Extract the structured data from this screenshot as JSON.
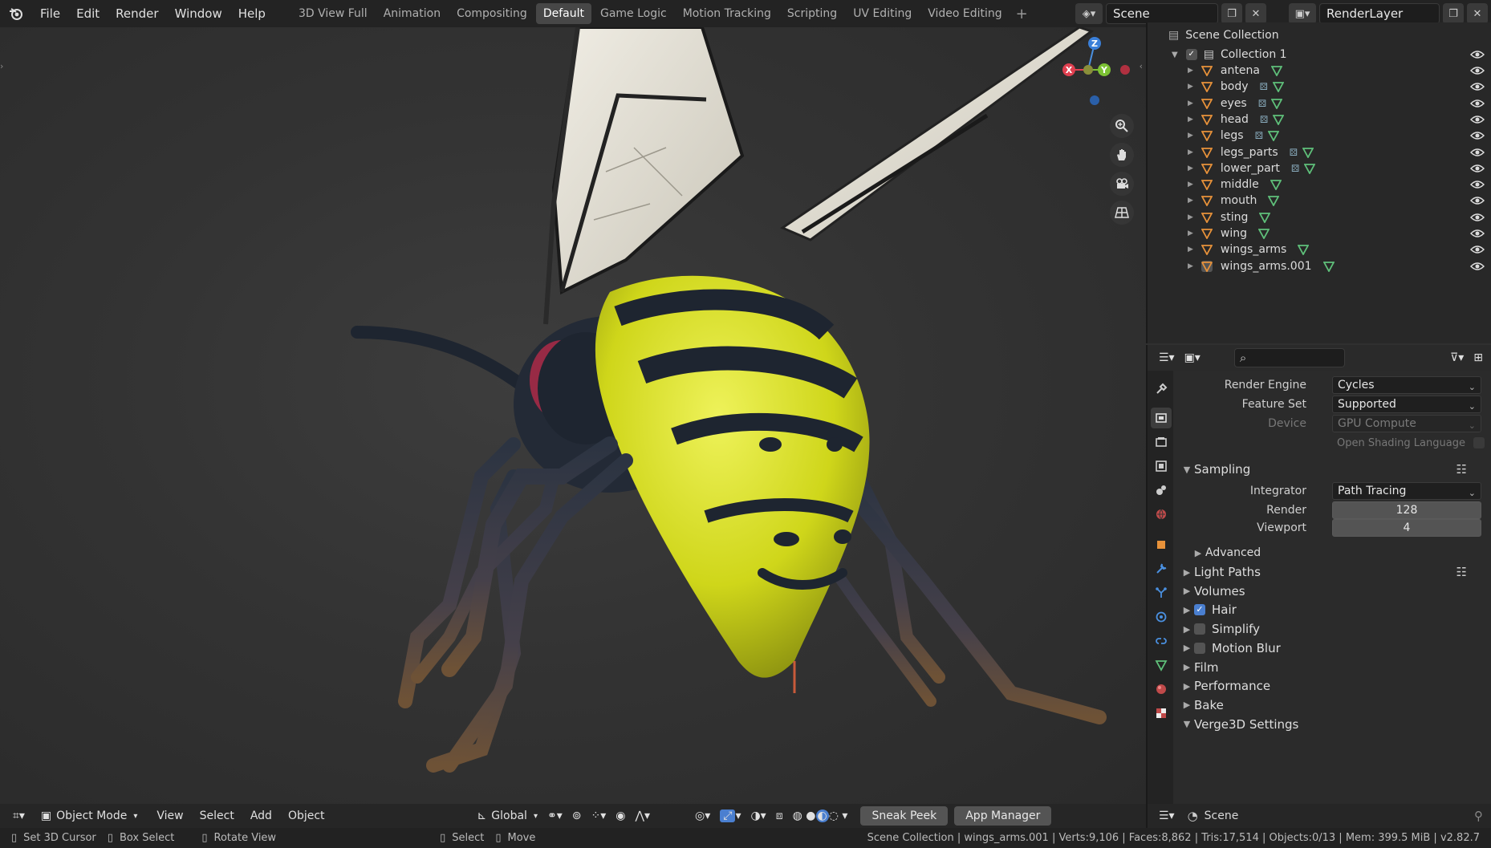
{
  "menu": [
    "File",
    "Edit",
    "Render",
    "Window",
    "Help"
  ],
  "workspaces": [
    "3D View Full",
    "Animation",
    "Compositing",
    "Default",
    "Game Logic",
    "Motion Tracking",
    "Scripting",
    "UV Editing",
    "Video Editing"
  ],
  "active_workspace": "Default",
  "add_workspace": "+",
  "scene_name": "Scene",
  "render_layer": "RenderLayer",
  "outliner": {
    "root": "Scene Collection",
    "collection": "Collection 1",
    "objects": [
      "antena",
      "body",
      "eyes",
      "head",
      "legs",
      "legs_parts",
      "lower_part",
      "middle",
      "mouth",
      "sting",
      "wing",
      "wings_arms",
      "wings_arms.001"
    ],
    "objects_with_modifiers": [
      "body",
      "eyes",
      "head",
      "legs",
      "legs_parts",
      "lower_part"
    ]
  },
  "properties": {
    "render_engine_label": "Render Engine",
    "render_engine": "Cycles",
    "feature_set_label": "Feature Set",
    "feature_set": "Supported",
    "device_label": "Device",
    "device": "GPU Compute",
    "osl_label": "Open Shading Language",
    "sampling": "Sampling",
    "integrator_label": "Integrator",
    "integrator": "Path Tracing",
    "render_label": "Render",
    "render_samples": "128",
    "viewport_label": "Viewport",
    "viewport_samples": "4",
    "advanced": "Advanced",
    "sections": [
      {
        "label": "Light Paths",
        "checkbox": null
      },
      {
        "label": "Volumes",
        "checkbox": null
      },
      {
        "label": "Hair",
        "checkbox": true
      },
      {
        "label": "Simplify",
        "checkbox": false
      },
      {
        "label": "Motion Blur",
        "checkbox": false
      },
      {
        "label": "Film",
        "checkbox": null
      },
      {
        "label": "Performance",
        "checkbox": null
      },
      {
        "label": "Bake",
        "checkbox": null
      },
      {
        "label": "Verge3D Settings",
        "checkbox": null
      }
    ],
    "footer_scene": "Scene"
  },
  "viewport_header": {
    "mode": "Object Mode",
    "menus": [
      "View",
      "Select",
      "Add",
      "Object"
    ],
    "orientation": "Global",
    "sneak_peek": "Sneak Peek",
    "app_manager": "App Manager"
  },
  "gizmo": {
    "z": "Z",
    "y": "Y",
    "x": "X"
  },
  "status": {
    "set_cursor": "Set 3D Cursor",
    "box_select": "Box Select",
    "rotate_view": "Rotate View",
    "select": "Select",
    "move": "Move",
    "stats": "Scene Collection | wings_arms.001 | Verts:9,106 | Faces:8,862 | Tris:17,514 | Objects:0/13 | Mem: 399.5 MiB | v2.82.7"
  },
  "colors": {
    "accent": "#4a7fd0",
    "mesh_orange": "#e8923a",
    "mesh_green": "#5fc07a",
    "bee_yellow": "#d9e020",
    "bee_dark": "#1e2530"
  }
}
